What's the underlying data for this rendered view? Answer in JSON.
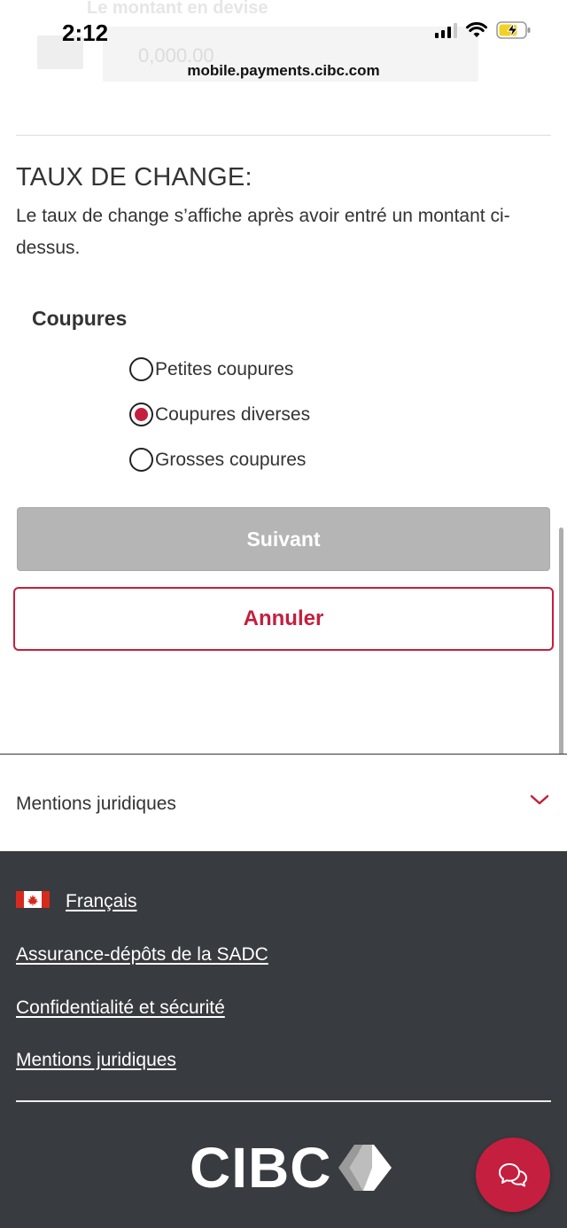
{
  "background_ghost": {
    "label": "Le montant en devise",
    "input_value": "0,000.00"
  },
  "status_bar": {
    "time": "2:12",
    "url": "mobile.payments.cibc.com"
  },
  "exchange_rate": {
    "title": "TAUX DE CHANGE:",
    "description": "Le taux de change s’affiche après avoir entré un montant ci-dessus."
  },
  "denominations": {
    "title": "Coupures",
    "options": [
      {
        "label": "Petites coupures",
        "selected": false
      },
      {
        "label": "Coupures diverses",
        "selected": true
      },
      {
        "label": "Grosses coupures",
        "selected": false
      }
    ]
  },
  "buttons": {
    "next_label": "Suivant",
    "cancel_label": "Annuler"
  },
  "legal": {
    "label": "Mentions juridiques"
  },
  "footer": {
    "language_label": "Français",
    "links": [
      "Assurance-dépôts de la SADC",
      "Confidentialité et sécurité",
      "Mentions juridiques"
    ],
    "logo_text": "CIBC"
  },
  "colors": {
    "accent": "#c41f3e",
    "footer_bg": "#383b3f",
    "disabled_button": "#b5b5b5"
  },
  "icons": {
    "chat": "chat-bubbles-icon",
    "chevron": "chevron-down-icon",
    "flag": "canada-flag-icon"
  }
}
